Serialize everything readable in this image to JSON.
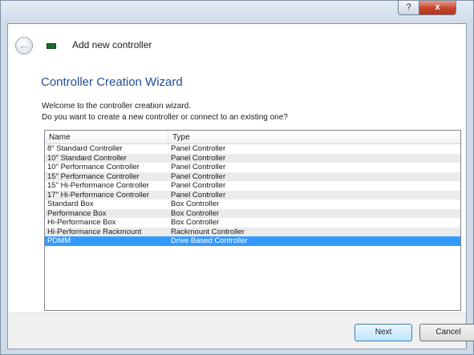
{
  "titlebar": {
    "help_label": "?",
    "close_label": "x"
  },
  "header": {
    "back_icon": "back-arrow",
    "title": "Add new controller"
  },
  "wizard": {
    "title": "Controller Creation Wizard",
    "intro_line1": "Welcome to the controller creation wizard.",
    "intro_line2": "Do you want to create a new controller or connect to an existing one?"
  },
  "list": {
    "columns": [
      "Name",
      "Type"
    ],
    "rows": [
      {
        "name": "8\" Standard Controller",
        "type": "Panel Controller"
      },
      {
        "name": "10\" Standard Controller",
        "type": "Panel Controller"
      },
      {
        "name": "10\" Performance Controller",
        "type": "Panel Controller"
      },
      {
        "name": "15\" Performance Controller",
        "type": "Panel Controller"
      },
      {
        "name": "15\" Hi-Performance Controller",
        "type": "Panel Controller"
      },
      {
        "name": "17\" Hi-Performance Controller",
        "type": "Panel Controller"
      },
      {
        "name": "Standard Box",
        "type": "Box Controller"
      },
      {
        "name": "Performance Box",
        "type": "Box Controller"
      },
      {
        "name": "Hi-Performance Box",
        "type": "Box Controller"
      },
      {
        "name": "Hi-Performance Rackmount",
        "type": "Rackmount Controller"
      },
      {
        "name": "PDMM",
        "type": "Drive Based Controller"
      }
    ],
    "selected_index": 10
  },
  "footer": {
    "next_label": "Next",
    "cancel_label": "Cancel"
  },
  "colors": {
    "accent_title": "#1e4f99",
    "selection": "#3399ff",
    "close_button": "#c5432b"
  }
}
